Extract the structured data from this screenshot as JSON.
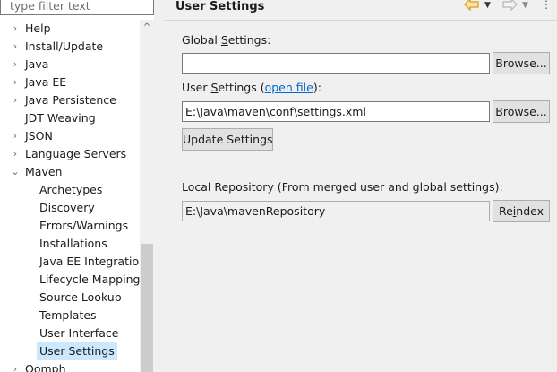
{
  "filter": {
    "placeholder": "type filter text"
  },
  "tree": {
    "items": [
      {
        "label": "Help",
        "expander": "›"
      },
      {
        "label": "Install/Update",
        "expander": "›"
      },
      {
        "label": "Java",
        "expander": "›"
      },
      {
        "label": "Java EE",
        "expander": "›"
      },
      {
        "label": "Java Persistence",
        "expander": "›"
      },
      {
        "label": "JDT Weaving",
        "expander": ""
      },
      {
        "label": "JSON",
        "expander": "›"
      },
      {
        "label": "Language Servers",
        "expander": "›"
      },
      {
        "label": "Maven",
        "expander": "⌄"
      },
      {
        "label": "Archetypes"
      },
      {
        "label": "Discovery"
      },
      {
        "label": "Errors/Warnings"
      },
      {
        "label": "Installations"
      },
      {
        "label": "Java EE Integration"
      },
      {
        "label": "Lifecycle Mappings"
      },
      {
        "label": "Source Lookup"
      },
      {
        "label": "Templates"
      },
      {
        "label": "User Interface"
      },
      {
        "label": "User Settings",
        "selected": true
      },
      {
        "label": "Oomph",
        "expander": "›"
      }
    ],
    "selected_color": "#cce8ff"
  },
  "scrollbar": {
    "up_arrow": "^"
  },
  "header": {
    "title": "User Settings",
    "back_icon": "back-arrow-icon",
    "forward_icon": "forward-arrow-icon",
    "dropdown_glyph": "▼",
    "view_menu_glyph": "⋮"
  },
  "global_settings": {
    "label_pre": "Global ",
    "label_mnemonic": "S",
    "label_post": "ettings:",
    "value": "",
    "browse_label": "Browse..."
  },
  "user_settings": {
    "label_pre": "User ",
    "label_mnemonic": "S",
    "label_post": "ettings (",
    "link": "open file",
    "label_end": "):",
    "value": "E:\\Java\\maven\\conf\\settings.xml",
    "browse_label": "Browse...",
    "update_label": "Update Settings"
  },
  "local_repository": {
    "label": "Local Repository (From merged user and global settings):",
    "value": "E:\\Java\\mavenRepository",
    "reindex_pre": "Re",
    "reindex_mnemonic": "i",
    "reindex_post": "ndex"
  }
}
